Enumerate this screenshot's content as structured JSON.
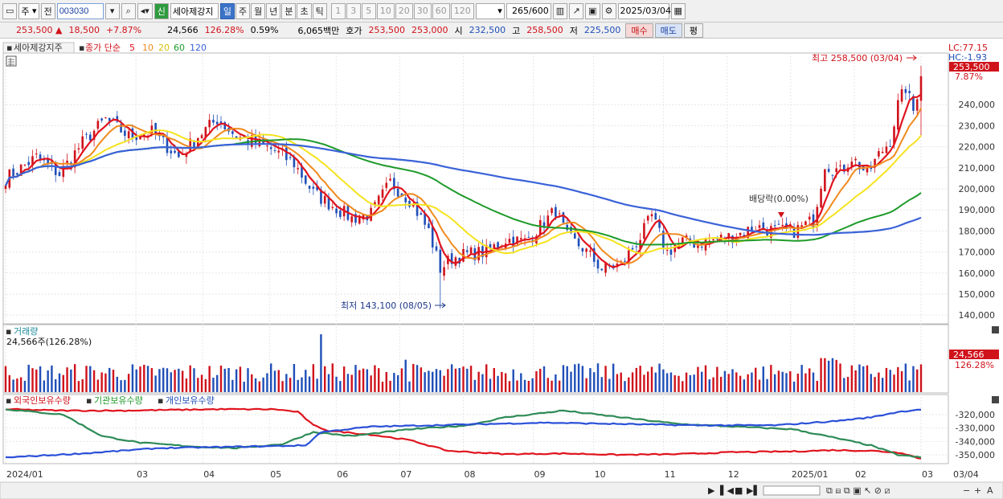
{
  "toolbar": {
    "market_label": "주",
    "prev_label": "전",
    "code": "003030",
    "stock_name": "세아제강지",
    "new_badge": "신",
    "periods": [
      "일",
      "주",
      "월",
      "년",
      "분",
      "초",
      "틱"
    ],
    "active_period": "일",
    "intervals": [
      "1",
      "3",
      "5",
      "10",
      "20",
      "30",
      "60",
      "120"
    ],
    "count": "265",
    "count_max": "/600",
    "date": "2025/03/04"
  },
  "quote": {
    "price": "253,500",
    "change": "18,500",
    "change_pct": "+7.87%",
    "volume": "24,566",
    "volume_ratio": "126.28%",
    "turnover_pct": "0.59%",
    "amount": "6,065백만",
    "bid_label": "호가",
    "ask": "253,500",
    "bid": "253,000",
    "open_label": "시",
    "open": "232,500",
    "high_label": "고",
    "high": "258,500",
    "low_label": "저",
    "low": "225,500",
    "buy_label": "매수",
    "sell_label": "매도",
    "eval_label": "평"
  },
  "colors": {
    "up": "#d0121b",
    "down": "#1f4fb8",
    "ma5": "#e0141e",
    "ma10": "#f08a1e",
    "ma20": "#f5e31e",
    "ma60": "#1e9a2a",
    "ma120": "#3a62d8"
  },
  "price_panel": {
    "stock_label": "세아제강지주",
    "indicator_title": "종가 단순",
    "ma_periods": [
      "5",
      "10",
      "20",
      "60",
      "120"
    ],
    "lc": "LC:77.15",
    "hc": "HC:-1.93",
    "last_price": "253,500",
    "last_pct": "7.87%",
    "high_annotation": "최고 258,500 (03/04)",
    "low_annotation": "최저 143,100 (08/05)",
    "dividend_annotation": "배당락(0.00%)"
  },
  "volume_panel": {
    "title": "거래량",
    "value": "24,566주(126.28%)",
    "last_volume": "24,566",
    "last_ratio": "126.28%"
  },
  "holding_panel": {
    "foreign_label": "외국인보유수량",
    "inst_label": "기관보유수량",
    "indiv_label": "개인보유수량"
  },
  "x_axis": {
    "labels": [
      "2024/01",
      "03",
      "04",
      "05",
      "06",
      "07",
      "08",
      "09",
      "10",
      "11",
      "12",
      "2025/01",
      "02",
      "03"
    ],
    "right_label": "03/04"
  },
  "chart_data": {
    "type": "candlestick",
    "price_axis": [
      "240,000",
      "230,000",
      "220,000",
      "210,000",
      "200,000",
      "190,000",
      "180,000",
      "170,000",
      "160,000",
      "150,000",
      "140,000"
    ],
    "ylim": [
      137000,
      263000
    ],
    "holding_axis": [
      "-320,000",
      "-330,000",
      "-340,000",
      "-350,000"
    ],
    "holding_ylim": [
      -356000,
      -314000
    ],
    "price_anchors": [
      [
        0,
        205000
      ],
      [
        8,
        215000
      ],
      [
        14,
        207000
      ],
      [
        20,
        222000
      ],
      [
        26,
        233000
      ],
      [
        32,
        225000
      ],
      [
        38,
        227000
      ],
      [
        45,
        215000
      ],
      [
        50,
        225000
      ],
      [
        55,
        233000
      ],
      [
        60,
        225000
      ],
      [
        65,
        222000
      ],
      [
        70,
        218000
      ],
      [
        75,
        212000
      ],
      [
        80,
        198000
      ],
      [
        85,
        192000
      ],
      [
        90,
        186000
      ],
      [
        95,
        188000
      ],
      [
        100,
        203000
      ],
      [
        105,
        195000
      ],
      [
        110,
        180000
      ],
      [
        113,
        162000
      ],
      [
        116,
        167000
      ],
      [
        120,
        169000
      ],
      [
        125,
        170000
      ],
      [
        130,
        176000
      ],
      [
        135,
        175000
      ],
      [
        140,
        184000
      ],
      [
        143,
        190000
      ],
      [
        146,
        177000
      ],
      [
        150,
        172000
      ],
      [
        155,
        162000
      ],
      [
        160,
        164000
      ],
      [
        165,
        177000
      ],
      [
        168,
        187000
      ],
      [
        172,
        170000
      ],
      [
        176,
        175000
      ],
      [
        180,
        174000
      ],
      [
        185,
        176000
      ],
      [
        190,
        178000
      ],
      [
        195,
        182000
      ],
      [
        200,
        180000
      ],
      [
        205,
        180000
      ],
      [
        210,
        185000
      ],
      [
        213,
        212000
      ],
      [
        217,
        208000
      ],
      [
        220,
        215000
      ],
      [
        224,
        207000
      ],
      [
        227,
        216000
      ],
      [
        230,
        223000
      ],
      [
        232,
        240000
      ],
      [
        234,
        248000
      ],
      [
        236,
        237000
      ],
      [
        238,
        253500
      ]
    ],
    "foreign_anchors": [
      [
        0,
        -316000
      ],
      [
        15,
        -317000
      ],
      [
        30,
        -317000
      ],
      [
        55,
        -316000
      ],
      [
        70,
        -316000
      ],
      [
        76,
        -318000
      ],
      [
        80,
        -328000
      ],
      [
        84,
        -332000
      ],
      [
        95,
        -335000
      ],
      [
        105,
        -339000
      ],
      [
        115,
        -347000
      ],
      [
        130,
        -349500
      ],
      [
        145,
        -349000
      ],
      [
        160,
        -350000
      ],
      [
        175,
        -349500
      ],
      [
        190,
        -348000
      ],
      [
        205,
        -347500
      ],
      [
        215,
        -346500
      ],
      [
        225,
        -347000
      ],
      [
        233,
        -348500
      ],
      [
        238,
        -353000
      ]
    ],
    "inst_anchors": [
      [
        0,
        -316000
      ],
      [
        15,
        -320000
      ],
      [
        25,
        -336000
      ],
      [
        35,
        -341000
      ],
      [
        50,
        -344000
      ],
      [
        60,
        -345000
      ],
      [
        72,
        -342000
      ],
      [
        80,
        -333000
      ],
      [
        90,
        -336000
      ],
      [
        105,
        -331000
      ],
      [
        120,
        -328000
      ],
      [
        130,
        -322000
      ],
      [
        145,
        -317000
      ],
      [
        160,
        -322000
      ],
      [
        175,
        -327000
      ],
      [
        190,
        -329000
      ],
      [
        205,
        -331000
      ],
      [
        215,
        -337000
      ],
      [
        225,
        -343000
      ],
      [
        232,
        -350000
      ],
      [
        238,
        -352000
      ]
    ],
    "indiv_anchors": [
      [
        0,
        -352000
      ],
      [
        20,
        -349000
      ],
      [
        40,
        -345000
      ],
      [
        60,
        -344000
      ],
      [
        78,
        -343000
      ],
      [
        82,
        -333000
      ],
      [
        95,
        -329000
      ],
      [
        110,
        -328000
      ],
      [
        125,
        -327000
      ],
      [
        140,
        -326000
      ],
      [
        160,
        -327000
      ],
      [
        180,
        -328000
      ],
      [
        200,
        -328000
      ],
      [
        215,
        -325000
      ],
      [
        225,
        -322000
      ],
      [
        232,
        -318000
      ],
      [
        238,
        -316000
      ]
    ]
  }
}
